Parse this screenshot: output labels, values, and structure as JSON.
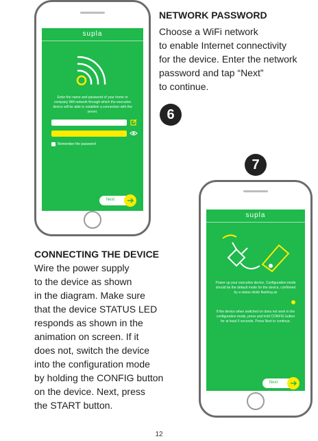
{
  "phone1": {
    "logo": "supla",
    "description": "Enter the name and password of your home or company Wifi network through which the executive device will be able to establish a connection with the server.",
    "remember_label": "Remember the password",
    "next_label": "Next"
  },
  "network_password": {
    "title": "NETWORK PASSWORD",
    "lines": [
      "Choose a WiFi network",
      "to enable Internet connectivity",
      "for the device. Enter the network",
      "password and tap “Next”",
      "to continue."
    ]
  },
  "step6": "6",
  "step7": "7",
  "phone2": {
    "logo": "supla",
    "description_1": "Power up your executive device. Configuration mode should be the default mode for the device, confirmed by a status diode flashing as",
    "description_2": "If the device when switched on does not work in the configuration mode, press and hold CONFIG button for at least 5 seconds. Press Next to continue.",
    "next_label": "Next"
  },
  "connecting": {
    "title": "CONNECTING THE DEVICE",
    "lines": [
      "Wire the power supply",
      "to the device as shown",
      "in the diagram. Make sure",
      "that the device STATUS LED",
      "responds as shown in the",
      "animation on screen. If it",
      "does not, switch the device",
      "into the configuration mode",
      "by holding the CONFIG button",
      "on the device. Next, press",
      "the START button."
    ]
  },
  "page_number": "12",
  "colors": {
    "screen_green": "#1fb94c",
    "accent_yellow": "#ffeb00"
  }
}
